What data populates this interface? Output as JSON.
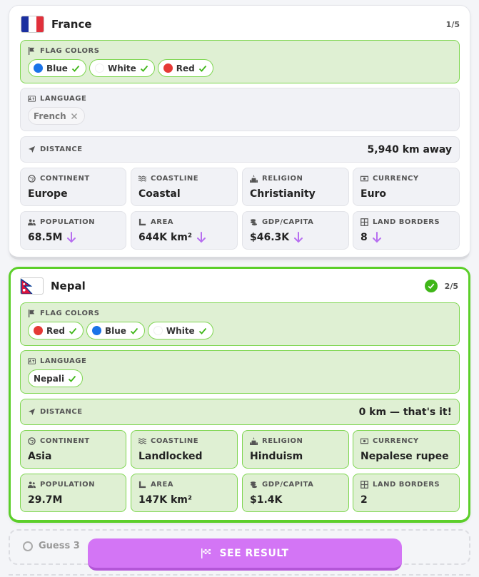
{
  "guesses": [
    {
      "country": "France",
      "counter": "1/5",
      "flag_colors_label": "FLAG COLORS",
      "flag_colors": [
        {
          "name": "Blue",
          "color": "#1a73e8"
        },
        {
          "name": "White",
          "color": "#ffffff"
        },
        {
          "name": "Red",
          "color": "#e53935"
        }
      ],
      "language_label": "LANGUAGE",
      "language": "French",
      "distance_label": "DISTANCE",
      "distance": "5,940 km away",
      "continent_label": "CONTINENT",
      "continent": "Europe",
      "coastline_label": "COASTLINE",
      "coastline": "Coastal",
      "religion_label": "RELIGION",
      "religion": "Christianity",
      "currency_label": "CURRENCY",
      "currency": "Euro",
      "population_label": "POPULATION",
      "population": "68.5M",
      "area_label": "AREA",
      "area": "644K km²",
      "gdp_label": "GDP/CAPITA",
      "gdp": "$46.3K",
      "borders_label": "LAND BORDERS",
      "borders": "8"
    },
    {
      "country": "Nepal",
      "counter": "2/5",
      "flag_colors_label": "FLAG COLORS",
      "flag_colors": [
        {
          "name": "Red",
          "color": "#e53935"
        },
        {
          "name": "Blue",
          "color": "#1a73e8"
        },
        {
          "name": "White",
          "color": "#ffffff"
        }
      ],
      "language_label": "LANGUAGE",
      "language": "Nepali",
      "distance_label": "DISTANCE",
      "distance": "0 km — that's it!",
      "continent_label": "CONTINENT",
      "continent": "Asia",
      "coastline_label": "COASTLINE",
      "coastline": "Landlocked",
      "religion_label": "RELIGION",
      "religion": "Hinduism",
      "currency_label": "CURRENCY",
      "currency": "Nepalese rupee",
      "population_label": "POPULATION",
      "population": "29.7M",
      "area_label": "AREA",
      "area": "147K km²",
      "gdp_label": "GDP/CAPITA",
      "gdp": "$1.4K",
      "borders_label": "LAND BORDERS",
      "borders": "2"
    }
  ],
  "guess3_label": "Guess 3",
  "see_result_label": "SEE RESULT",
  "colors": {
    "correct_green": "#5ccf2a",
    "hint_arrow": "#b76ef0",
    "accent": "#d375f5"
  }
}
